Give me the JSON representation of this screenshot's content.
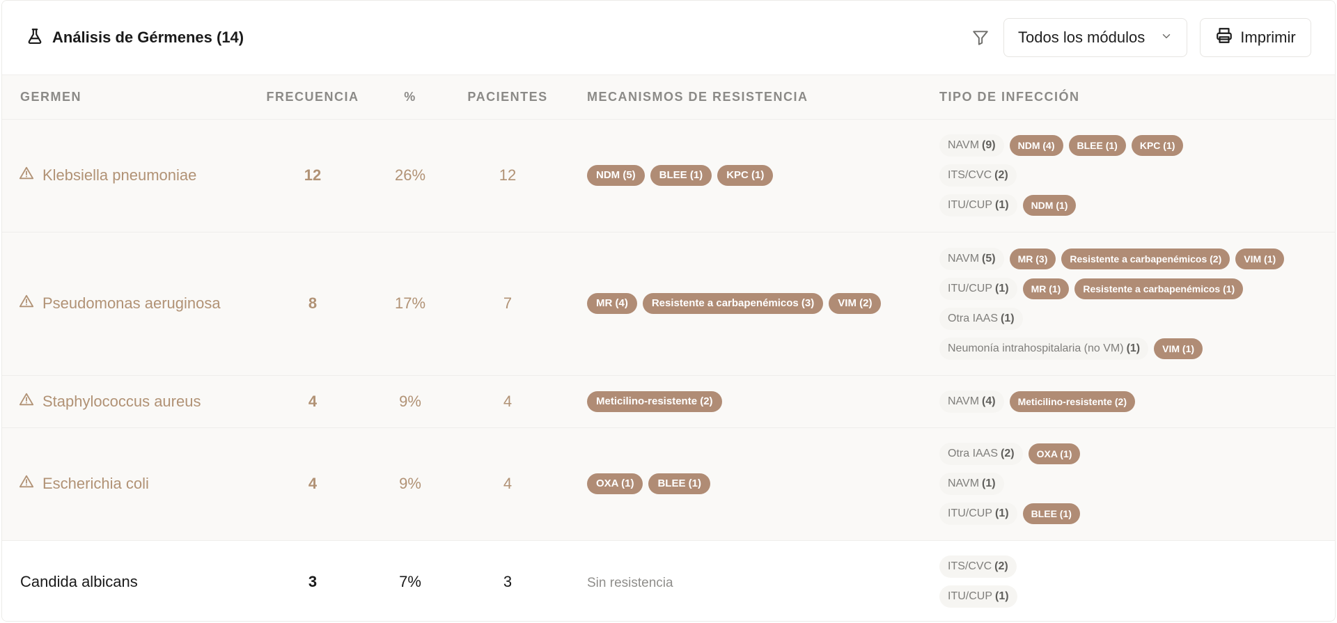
{
  "header": {
    "title": "Análisis de Gérmenes (14)",
    "module_select": "Todos los módulos",
    "print_label": "Imprimir"
  },
  "columns": {
    "germen": "GERMEN",
    "frecuencia": "FRECUENCIA",
    "pct": "%",
    "pacientes": "PACIENTES",
    "mecanismos": "MECANISMOS DE RESISTENCIA",
    "tipo": "TIPO DE INFECCIÓN"
  },
  "rows": [
    {
      "name": "Klebsiella pneumoniae",
      "warning": true,
      "freq": "12",
      "pct": "26%",
      "pacientes": "12",
      "mecanismos": [
        "NDM (5)",
        "BLEE (1)",
        "KPC (1)"
      ],
      "sin_resistencia": "",
      "infecciones": [
        {
          "tipo": "NAVM",
          "count": "(9)",
          "mech": [
            "NDM (4)",
            "BLEE (1)",
            "KPC (1)"
          ]
        },
        {
          "tipo": "ITS/CVC",
          "count": "(2)",
          "mech": []
        },
        {
          "tipo": "ITU/CUP",
          "count": "(1)",
          "mech": [
            "NDM (1)"
          ]
        }
      ]
    },
    {
      "name": "Pseudomonas aeruginosa",
      "warning": true,
      "freq": "8",
      "pct": "17%",
      "pacientes": "7",
      "mecanismos": [
        "MR (4)",
        "Resistente a carbapenémicos (3)",
        "VIM (2)"
      ],
      "sin_resistencia": "",
      "infecciones": [
        {
          "tipo": "NAVM",
          "count": "(5)",
          "mech": [
            "MR (3)",
            "Resistente a carbapenémicos (2)",
            "VIM (1)"
          ]
        },
        {
          "tipo": "ITU/CUP",
          "count": "(1)",
          "mech": [
            "MR (1)",
            "Resistente a carbapenémicos (1)"
          ]
        },
        {
          "tipo": "Otra IAAS",
          "count": "(1)",
          "mech": []
        },
        {
          "tipo": "Neumonía intrahospitalaria (no VM)",
          "count": "(1)",
          "mech": [
            "VIM (1)"
          ]
        }
      ]
    },
    {
      "name": "Staphylococcus aureus",
      "warning": true,
      "freq": "4",
      "pct": "9%",
      "pacientes": "4",
      "mecanismos": [
        "Meticilino-resistente (2)"
      ],
      "sin_resistencia": "",
      "infecciones": [
        {
          "tipo": "NAVM",
          "count": "(4)",
          "mech": [
            "Meticilino-resistente (2)"
          ]
        }
      ]
    },
    {
      "name": "Escherichia coli",
      "warning": true,
      "freq": "4",
      "pct": "9%",
      "pacientes": "4",
      "mecanismos": [
        "OXA (1)",
        "BLEE (1)"
      ],
      "sin_resistencia": "",
      "infecciones": [
        {
          "tipo": "Otra IAAS",
          "count": "(2)",
          "mech": [
            "OXA (1)"
          ]
        },
        {
          "tipo": "NAVM",
          "count": "(1)",
          "mech": []
        },
        {
          "tipo": "ITU/CUP",
          "count": "(1)",
          "mech": [
            "BLEE (1)"
          ]
        }
      ]
    },
    {
      "name": "Candida albicans",
      "warning": false,
      "freq": "3",
      "pct": "7%",
      "pacientes": "3",
      "mecanismos": [],
      "sin_resistencia": "Sin resistencia",
      "infecciones": [
        {
          "tipo": "ITS/CVC",
          "count": "(2)",
          "mech": []
        },
        {
          "tipo": "ITU/CUP",
          "count": "(1)",
          "mech": []
        }
      ]
    }
  ],
  "colors": {
    "accent": "#b08c75",
    "warn_text": "#b19275",
    "row_bg": "#faf9f7"
  },
  "icons": {
    "title": "flask-icon",
    "filter": "filter-icon",
    "select": "chevron-down-icon",
    "print": "printer-icon",
    "warning": "warning-triangle-icon"
  }
}
